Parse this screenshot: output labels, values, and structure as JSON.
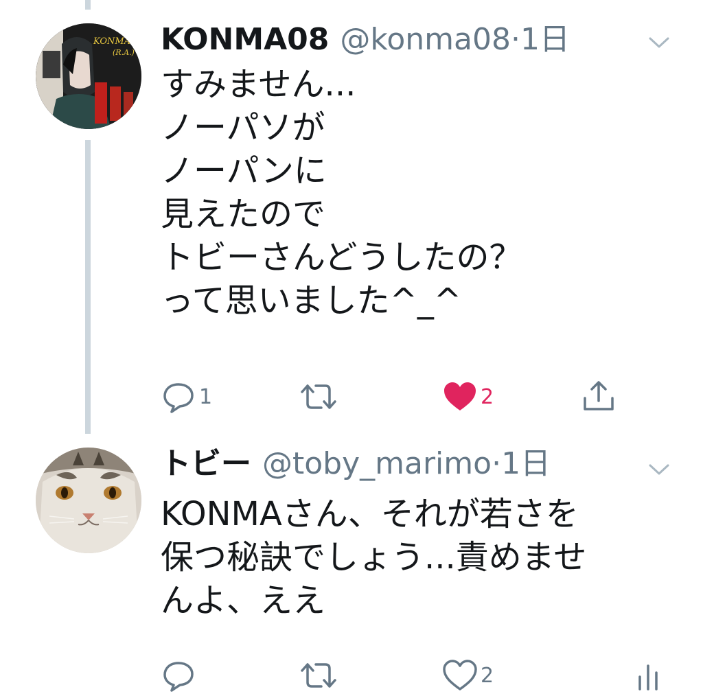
{
  "tweets": [
    {
      "display_name": "KONMA08",
      "handle": "@konma08",
      "separator": "·",
      "time": "1日",
      "avatar_text": "KONMA",
      "avatar_subtext": "(R.A.)",
      "body_lines": [
        "すみません...",
        "ノーパソが",
        "ノーパンに",
        "見えたので",
        "トビーさんどうしたの？",
        "って思いました^_^"
      ],
      "reply_count": "1",
      "like_count": "2",
      "liked": true,
      "last_action_icon": "share-icon"
    },
    {
      "display_name": "トビー",
      "handle": "@toby_marimo",
      "separator": "·",
      "time": "1日",
      "body_lines": [
        "KONMAさん、それが若さを",
        "保つ秘訣でしょう...責めませ",
        "んよ、ええ"
      ],
      "like_count": "2",
      "liked": false,
      "last_action_icon": "analytics-icon"
    }
  ],
  "colors": {
    "text": "#14171a",
    "secondary": "#657786",
    "like_active": "#e0245e",
    "thread_line": "#ccd6dd"
  }
}
